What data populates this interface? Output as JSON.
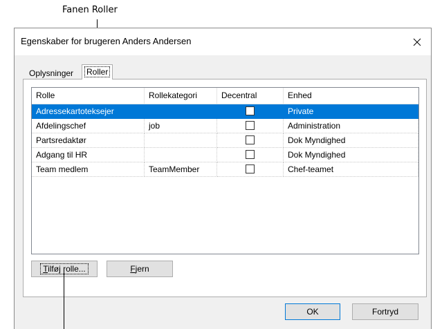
{
  "annotations": {
    "top_label": "Fanen Roller"
  },
  "dialog": {
    "title": "Egenskaber for brugeren Anders Andersen",
    "close_glyph": "✕"
  },
  "tabs": [
    {
      "label": "Oplysninger",
      "active": false
    },
    {
      "label": "Roller",
      "active": true
    }
  ],
  "table": {
    "columns": [
      "Rolle",
      "Rollekategori",
      "Decentral",
      "Enhed"
    ],
    "rows": [
      {
        "rolle": "Adressekartoteksejer",
        "rollekategori": "",
        "decentral": false,
        "enhed": "Private",
        "selected": true
      },
      {
        "rolle": "Afdelingschef",
        "rollekategori": "job",
        "decentral": false,
        "enhed": "Administration",
        "selected": false
      },
      {
        "rolle": "Partsredaktør",
        "rollekategori": "",
        "decentral": false,
        "enhed": "Dok Myndighed",
        "selected": false
      },
      {
        "rolle": "Adgang til HR",
        "rollekategori": "",
        "decentral": false,
        "enhed": "Dok Myndighed",
        "selected": false
      },
      {
        "rolle": "Team medlem",
        "rollekategori": "TeamMember",
        "decentral": false,
        "enhed": "Chef-teamet",
        "selected": false
      }
    ]
  },
  "buttons": {
    "add_role_mnemonic": "T",
    "add_role_rest": "ilføj rolle...",
    "remove_mnemonic": "F",
    "remove_rest": "jern",
    "ok": "OK",
    "cancel": "Fortryd"
  },
  "colors": {
    "selection": "#0078d7",
    "dialog_bg": "#f0f0f0"
  }
}
